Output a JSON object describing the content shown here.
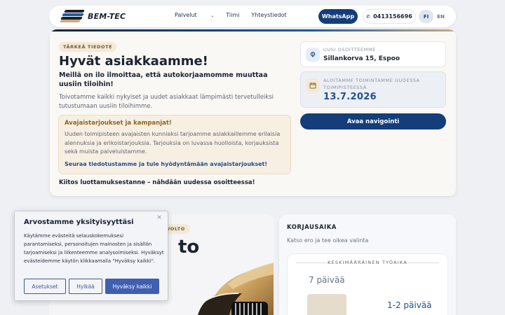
{
  "header": {
    "logo_text": "BEM-TEC",
    "nav": [
      "Palvelut",
      "Tiimi",
      "Yhteystiedot"
    ],
    "whatsapp_label": "WhatsApp",
    "phone": "0413156696",
    "lang_active": "FI",
    "lang_other": "EN"
  },
  "notice": {
    "badge": "TÄRKEÄ TIEDOTE",
    "title": "Hyvät asiakkaamme!",
    "subtitle": "Meillä on ilo ilmoittaa, että autokorjaamomme muuttaa uusiin tiloihin!",
    "intro": "Toivotamme kaikki nykyiset ja uudet asiakkaat lämpimästi tervetulleiksi tutustumaan uusiin tiloihimme.",
    "promo_title": "Avajaistarjoukset ja kampanjat!",
    "promo_body": "Uuden toimipisteen avajaisten kunniaksi tarjoamme asiakkaillemme erilaisia alennuksia ja erikoistarjouksia. Tarjouksia on luvassa huolloista, korjauksista sekä muista palveluistamme.",
    "promo_link": "Seuraa tiedotustamme ja tule hyödyntämään avajaistarjoukset!",
    "thanks": "Kiitos luottamuksestanne – nähdään uudessa osoitteessa!",
    "address_label": "UUSI OSOITTEEMME",
    "address_value": "Sillankorva 15, Espoo",
    "date_label": "ALOITAMME TOIMINTAMME UUDESSA TOIMIPISTEESSÄ",
    "date_value": "13.7.2026",
    "nav_button": "Avaa navigointi"
  },
  "lower": {
    "badge_fragment": "UOLTO",
    "big_fragment": "to",
    "repair_title": "KORJAUSAIKA",
    "repair_sub": "Katso ero ja tee oikea valinta",
    "avg_label": "KESKIMÄÄRÄINEN TYÖAIKA",
    "old_value": "7 päivää",
    "new_value": "1-2 päivää"
  },
  "cookie": {
    "title": "Arvostamme yksityisyyttäsi",
    "text": "Käytämme evästeitä selauskokemuksesi parantamiseksi, personoitujen mainosten ja sisällön tarjoamiseksi ja liikenteemme analysoimiseksi. Hyväksyt evästeidemme käytön klikkaamalla \"Hyväksy kaikki\".",
    "close": "×",
    "settings_label": "Asetukset",
    "reject_label": "Hylkää",
    "accept_label": "Hyväksy kaikki"
  },
  "colors": {
    "brand_navy": "#143d7a",
    "accent_gold": "#c8ae82",
    "cookie_accent": "#3f5fb0"
  }
}
